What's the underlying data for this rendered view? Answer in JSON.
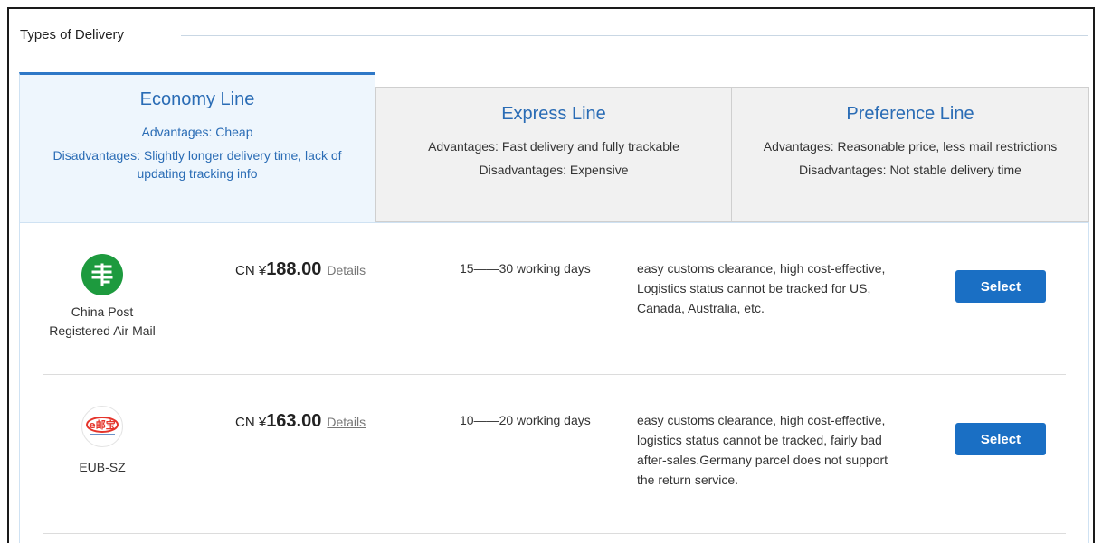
{
  "section": {
    "title": "Types of Delivery"
  },
  "tabs": [
    {
      "title": "Economy Line",
      "advantages": "Advantages: Cheap",
      "disadvantages": "Disadvantages: Slightly longer delivery time, lack of updating tracking info",
      "active": true
    },
    {
      "title": "Express Line",
      "advantages": "Advantages: Fast delivery and fully trackable",
      "disadvantages": "Disadvantages: Expensive",
      "active": false
    },
    {
      "title": "Preference Line",
      "advantages": "Advantages: Reasonable price, less mail restrictions",
      "disadvantages": "Disadvantages: Not stable delivery time",
      "active": false
    }
  ],
  "options": [
    {
      "carrier": "China Post Registered Air Mail",
      "logo_icon": "china-post-logo-icon",
      "currency": "CN ¥",
      "price": "188.00",
      "details_label": "Details",
      "days": "15——30 working days",
      "description": "easy customs clearance, high cost-effective, Logistics status cannot be tracked for US, Canada, Australia, etc.",
      "select_label": "Select"
    },
    {
      "carrier": "EUB-SZ",
      "logo_icon": "eub-logo-icon",
      "logo_text": "e邮宝",
      "currency": "CN ¥",
      "price": "163.00",
      "details_label": "Details",
      "days": "10——20 working days",
      "description": "easy customs clearance, high cost-effective, logistics status cannot be tracked, fairly bad after-sales.Germany parcel does not support the return service.",
      "select_label": "Select"
    }
  ],
  "colors": {
    "accent": "#2e78c7",
    "button": "#1a6fc4",
    "china_post_green": "#1d9a3e",
    "eub_red": "#e5342b"
  }
}
